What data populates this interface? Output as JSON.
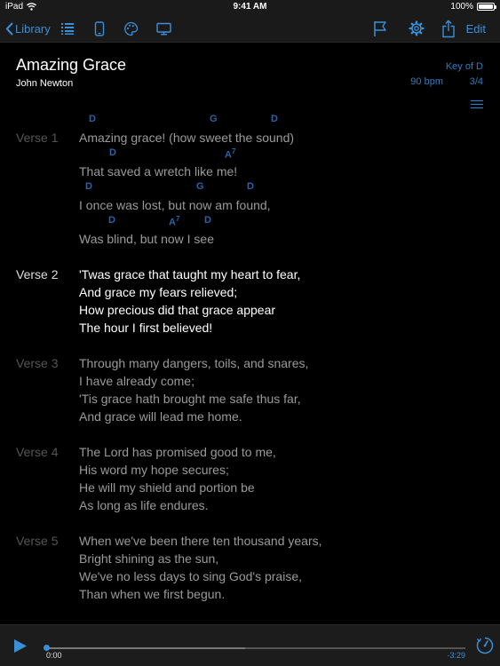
{
  "status_bar": {
    "carrier": "iPad",
    "time": "9:41 AM",
    "battery": "100%"
  },
  "toolbar": {
    "back_label": "Library",
    "edit_label": "Edit",
    "icons": [
      "outline-icon",
      "phone-icon",
      "palette-icon",
      "monitor-icon",
      "flag-icon",
      "gear-icon",
      "share-icon"
    ]
  },
  "song": {
    "title": "Amazing Grace",
    "author": "John Newton",
    "key": "Key of D",
    "bpm": "90 bpm",
    "time_signature": "3/4"
  },
  "verses": [
    {
      "label": "Verse 1",
      "lines": [
        {
          "text": "Amazing grace! (how sweet the sound)",
          "chords": [
            "D",
            "G",
            "D"
          ]
        },
        {
          "text": "That saved a wretch like me!",
          "chords": [
            "D",
            "A7"
          ]
        },
        {
          "text": "I once was lost, but now am found,",
          "chords": [
            "D",
            "G",
            "D"
          ]
        },
        {
          "text": "Was blind, but now I see",
          "chords": [
            "D",
            "A7",
            "D"
          ]
        }
      ]
    },
    {
      "label": "Verse 2",
      "lines": [
        {
          "text": "'Twas grace that taught my heart to fear,"
        },
        {
          "text": "And grace my fears relieved;"
        },
        {
          "text": "How precious did that grace appear"
        },
        {
          "text": "The hour I first believed!"
        }
      ]
    },
    {
      "label": "Verse 3",
      "lines": [
        {
          "text": "Through many dangers, toils, and snares,"
        },
        {
          "text": "I have already come;"
        },
        {
          "text": "'Tis grace hath brought me safe thus far,"
        },
        {
          "text": "And grace will lead me home."
        }
      ]
    },
    {
      "label": "Verse 4",
      "lines": [
        {
          "text": "The Lord has promised good to me,"
        },
        {
          "text": "His word my hope secures;"
        },
        {
          "text": "He will my shield and portion be"
        },
        {
          "text": "As long as life endures."
        }
      ]
    },
    {
      "label": "Verse 5",
      "lines": [
        {
          "text": "When we've been there ten thousand years,"
        },
        {
          "text": "Bright shining as the sun,"
        },
        {
          "text": "We've no less days to sing God's praise,"
        },
        {
          "text": "Than when we first begun."
        }
      ]
    }
  ],
  "player": {
    "elapsed": "0:00",
    "remaining": "-3:29",
    "progress": 0.0
  },
  "colors": {
    "accent": "#3a8fd9",
    "chord": "#2a63a6",
    "background": "#000000"
  }
}
